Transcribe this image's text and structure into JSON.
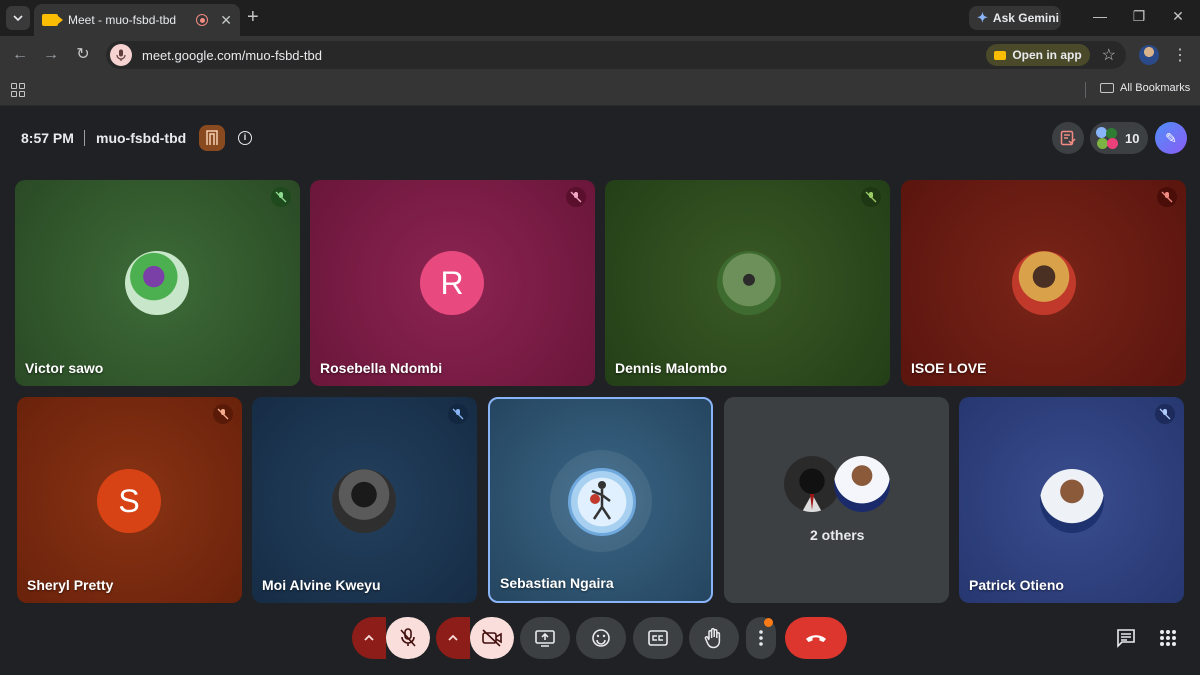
{
  "browser": {
    "tab_title": "Meet - muo-fsbd-tbd",
    "new_tab_symbol": "+",
    "gemini_label": "Ask Gemini",
    "url": "meet.google.com/muo-fsbd-tbd",
    "open_app_label": "Open in app",
    "all_bookmarks_label": "All Bookmarks"
  },
  "meeting": {
    "time": "8:57 PM",
    "code": "muo-fsbd-tbd",
    "participant_count": "10"
  },
  "participants": [
    {
      "name": "Victor sawo",
      "avatar": "photo",
      "muted": true
    },
    {
      "name": "Rosebella Ndombi",
      "avatar": "letter",
      "letter": "R",
      "muted": true
    },
    {
      "name": "Dennis Malombo",
      "avatar": "photo",
      "muted": true
    },
    {
      "name": "ISOE LOVE",
      "avatar": "photo",
      "muted": true
    },
    {
      "name": "Sheryl Pretty",
      "avatar": "letter",
      "letter": "S",
      "muted": true
    },
    {
      "name": "Moi Alvine Kweyu",
      "avatar": "photo",
      "muted": true
    },
    {
      "name": "Sebastian Ngaira",
      "avatar": "photo",
      "muted": false,
      "active_speaker": true
    },
    {
      "name": "Patrick Otieno",
      "avatar": "photo",
      "muted": true
    }
  ],
  "others_tile": {
    "label": "2 others"
  },
  "colors": {
    "victor_bg": "#2f5a2d",
    "rosebella_bg": "#7a1c45",
    "dennis_bg": "#2a4a1e",
    "isoe_bg": "#6a1c14",
    "sheryl_bg": "#7a2810",
    "moi_bg": "#1c3550",
    "sebastian_bg": "#2a4c66",
    "others_bg": "#3c4043",
    "patrick_bg": "#2d3f7c",
    "leave_red": "#dc362e",
    "active_border": "#8ab4f8"
  },
  "icons": {
    "mic": "mic-off-icon",
    "camera": "camera-off-icon",
    "present": "present-screen-icon",
    "emoji": "emoji-icon",
    "captions": "captions-icon",
    "hand": "raise-hand-icon",
    "more": "more-vert-icon",
    "leave": "call-end-icon",
    "chat": "chat-icon",
    "activities": "activities-icon"
  }
}
